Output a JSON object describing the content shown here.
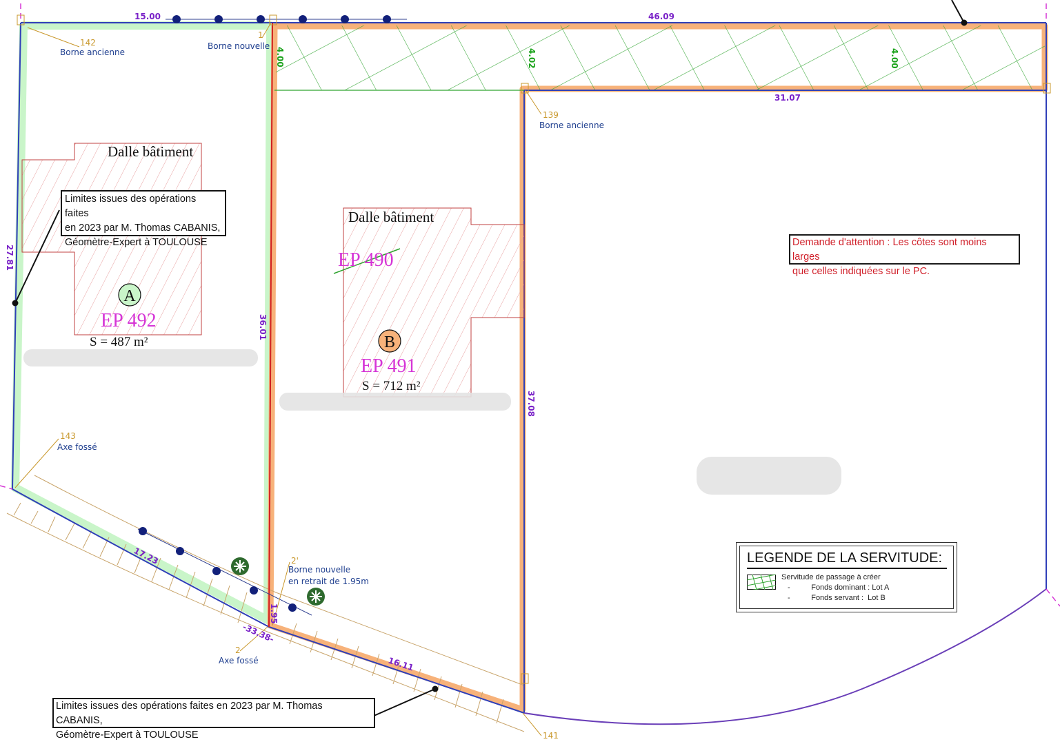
{
  "dimensions": {
    "top_left": "15.00",
    "top_right": "46.09",
    "inner_top": "31.07",
    "left": "27.81",
    "middle": "36.01",
    "right": "37.08",
    "easement_1": "4.00",
    "easement_2": "4.02",
    "easement_3": "4.00",
    "bottom_left": "17.23",
    "bottom_mid": "-33.38-",
    "bottom_right": "16.11",
    "retrait": "1.95"
  },
  "bornes": {
    "b142": {
      "num": "142",
      "label": "Borne ancienne"
    },
    "b1": {
      "num": "1",
      "label": "Borne nouvelle"
    },
    "b139": {
      "num": "139",
      "label": "Borne ancienne"
    },
    "b143": {
      "num": "143",
      "label": "Axe fossé"
    },
    "b2prime": {
      "num": "2'",
      "label_line1": "Borne nouvelle",
      "label_line2": "en retrait de 1.95m"
    },
    "b2": {
      "num": "2",
      "label": "Axe fossé"
    },
    "b141": {
      "num": "141"
    }
  },
  "buildings": {
    "a": {
      "label": "Dalle bâtiment"
    },
    "b": {
      "label": "Dalle bâtiment"
    }
  },
  "lots": {
    "a": {
      "letter": "A",
      "parcel": "EP 492",
      "area": "S = 487 m²",
      "color": "#c9f5c9"
    },
    "b": {
      "letter": "B",
      "parcel": "EP 491",
      "area": "S = 712 m²",
      "color": "#f7b27a"
    },
    "crossed_parcel": "EP 490"
  },
  "notes": {
    "top": [
      "Limites issues des opérations faites",
      "en 2023 par M. Thomas CABANIS,",
      "Géomètre-Expert à TOULOUSE"
    ],
    "bottom": [
      "Limites issues des opérations faites en 2023 par M. Thomas CABANIS,",
      "Géomètre-Expert à TOULOUSE"
    ],
    "warning": [
      "Demande d'attention : Les côtes sont moins larges",
      "que celles indiquées sur le PC."
    ]
  },
  "legend": {
    "title": "LEGENDE DE LA SERVITUDE:",
    "item": "Servitude de passage à créer",
    "dominant": "-          Fonds dominant : Lot A",
    "servant": "-          Fonds servant :  Lot B"
  },
  "colors": {
    "lot_a_border": "#c9f5c9",
    "lot_b_border": "#f7b27a",
    "boundary": "#2f3fb8",
    "easement_hatch": "#2ea32e",
    "parcel_label": "#d635d6",
    "dimension": "#7a22c8",
    "borne_text": "#1f3f8f",
    "borne_number": "#c9982c",
    "building_outline": "#c04040",
    "warning_text": "#d0202a"
  },
  "icons": [
    "tree-icon",
    "marker-dot-icon",
    "borne-marker-icon"
  ]
}
